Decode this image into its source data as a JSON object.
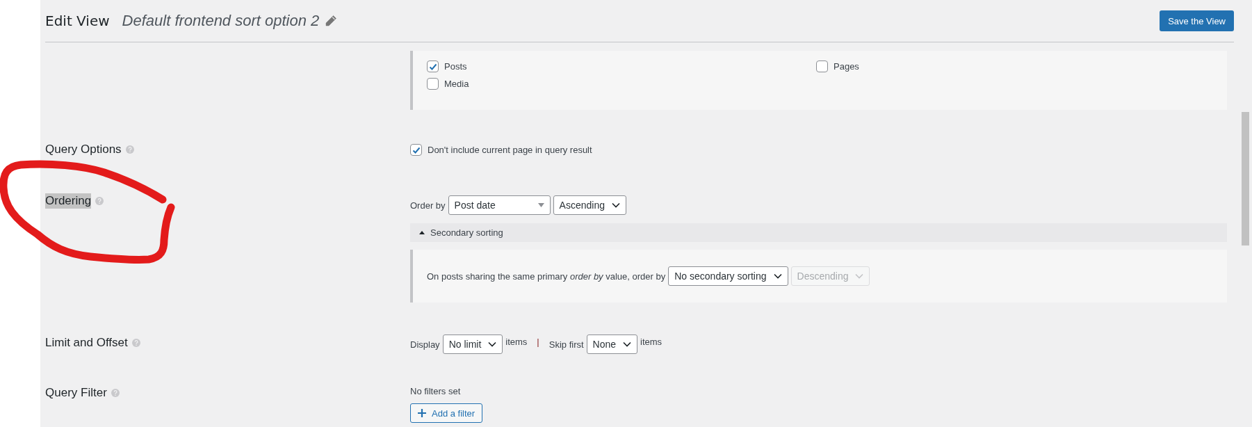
{
  "header": {
    "title": "Edit View",
    "view_name": "Default frontend sort option 2",
    "save_button": "Save the View"
  },
  "post_types": [
    {
      "label": "Posts",
      "checked": true
    },
    {
      "label": "Pages",
      "checked": false
    },
    {
      "label": "Media",
      "checked": false
    }
  ],
  "query_options": {
    "label": "Query Options",
    "highlighted": false,
    "checkbox": {
      "label": "Don't include current page in query result",
      "checked": true
    }
  },
  "ordering": {
    "label": "Ordering",
    "highlighted": true,
    "order_by_label": "Order by",
    "order_by": "Post date",
    "direction": "Ascending",
    "secondary": {
      "toggle": "Secondary sorting",
      "expanded": true,
      "text": "On posts sharing the same primary *order by* value, order by",
      "order_by": "No secondary sorting",
      "direction": "Descending",
      "direction_disabled": true
    }
  },
  "limit": {
    "label": "Limit and Offset",
    "highlighted": false,
    "display_label": "Display",
    "display": "No limit",
    "items_1": "items",
    "separator": "|",
    "skip_label": "Skip first",
    "skip": "None",
    "items_2": "items"
  },
  "filter": {
    "label": "Query Filter",
    "highlighted": false,
    "empty_text": "No filters set",
    "add_button": "Add a filter"
  },
  "annotation": {
    "kind": "loop"
  }
}
